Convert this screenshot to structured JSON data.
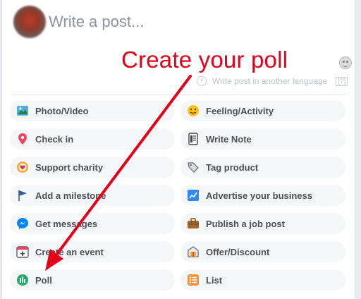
{
  "composer": {
    "placeholder": "Write a post...",
    "language_link": "Write post in another language",
    "language_help": "[?]"
  },
  "annotation": {
    "text": "Create your poll",
    "color": "#e3001b"
  },
  "options": [
    {
      "label": "Photo/Video",
      "icon": "photo-icon"
    },
    {
      "label": "Feeling/Activity",
      "icon": "smiley-icon"
    },
    {
      "label": "Check in",
      "icon": "location-pin-icon"
    },
    {
      "label": "Write Note",
      "icon": "note-icon"
    },
    {
      "label": "Support charity",
      "icon": "charity-icon"
    },
    {
      "label": "Tag product",
      "icon": "tag-icon"
    },
    {
      "label": "Add a milestone",
      "icon": "flag-icon"
    },
    {
      "label": "Advertise your business",
      "icon": "chart-icon"
    },
    {
      "label": "Get messages",
      "icon": "messenger-icon"
    },
    {
      "label": "Publish a job post",
      "icon": "briefcase-icon"
    },
    {
      "label": "Create an event",
      "icon": "calendar-plus-icon"
    },
    {
      "label": "Offer/Discount",
      "icon": "offer-icon"
    },
    {
      "label": "Poll",
      "icon": "poll-icon"
    },
    {
      "label": "List",
      "icon": "list-icon"
    }
  ],
  "colors": {
    "accent": "#e3001b",
    "pill_bg": "#f5f6f7",
    "label": "#4b4f56"
  }
}
